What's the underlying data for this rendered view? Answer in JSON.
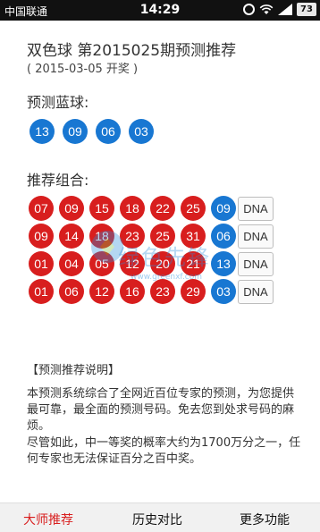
{
  "status_bar": {
    "carrier": "中国联通",
    "time": "14:29",
    "battery": "73"
  },
  "header": {
    "title": "双色球 第2015025期预测推荐",
    "subtitle": "( 2015-03-05 开奖 )"
  },
  "blue_prediction": {
    "label": "预测蓝球:",
    "balls": [
      "13",
      "09",
      "06",
      "03"
    ]
  },
  "combinations": {
    "label": "推荐组合:",
    "dna_label": "DNA",
    "rows": [
      {
        "red": [
          "07",
          "09",
          "15",
          "18",
          "22",
          "25"
        ],
        "blue": "09"
      },
      {
        "red": [
          "09",
          "14",
          "18",
          "23",
          "25",
          "31"
        ],
        "blue": "06"
      },
      {
        "red": [
          "01",
          "04",
          "05",
          "12",
          "20",
          "21"
        ],
        "blue": "13"
      },
      {
        "red": [
          "01",
          "06",
          "12",
          "16",
          "23",
          "29"
        ],
        "blue": "03"
      }
    ]
  },
  "watermark": {
    "text": "绿色先锋",
    "url": "www.greenxf.com"
  },
  "explanation": {
    "title": "【预测推荐说明】",
    "paragraph1": "本预测系统综合了全网近百位专家的预测，为您提供最可靠，最全面的预测号码。免去您到处求号码的麻烦。",
    "paragraph2": "尽管如此，中一等奖的概率大约为1700万分之一，任何专家也无法保证百分之百中奖。"
  },
  "bottom_nav": {
    "items": [
      {
        "label": "大师推荐",
        "active": true
      },
      {
        "label": "历史对比",
        "active": false
      },
      {
        "label": "更多功能",
        "active": false
      }
    ]
  },
  "colors": {
    "red_ball": "#d81e1e",
    "blue_ball": "#1877d2",
    "active_nav": "#d81e1e"
  }
}
